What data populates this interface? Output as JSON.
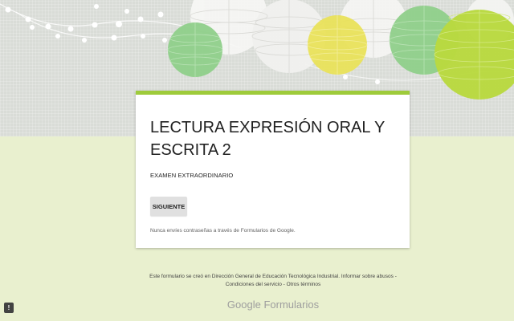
{
  "form": {
    "title": "LECTURA EXPRESIÓN ORAL Y ESCRITA 2",
    "description": "EXAMEN EXTRAORDINARIO",
    "next_label": "SIGUIENTE",
    "password_warning": "Nunca envíes contraseñas a través de Formularios de Google."
  },
  "footer": {
    "created_in": "Este formulario se creó en Dirección General de Educación Tecnológica Industrial.",
    "report_abuse": "Informar sobre abusos",
    "separator": "-",
    "terms": "Condiciones del servicio",
    "other_terms": "Otros términos",
    "brand_google": "Google",
    "brand_product": "Formularios"
  },
  "feedback": {
    "icon": "!"
  },
  "colors": {
    "accent": "#9ecb3b",
    "page_bg": "#e9f0cf",
    "header_bg": "#d9dcd7",
    "lantern_green": "#8fcf8a",
    "lantern_yellow": "#e9e15a",
    "lantern_lime": "#b9d93f"
  }
}
